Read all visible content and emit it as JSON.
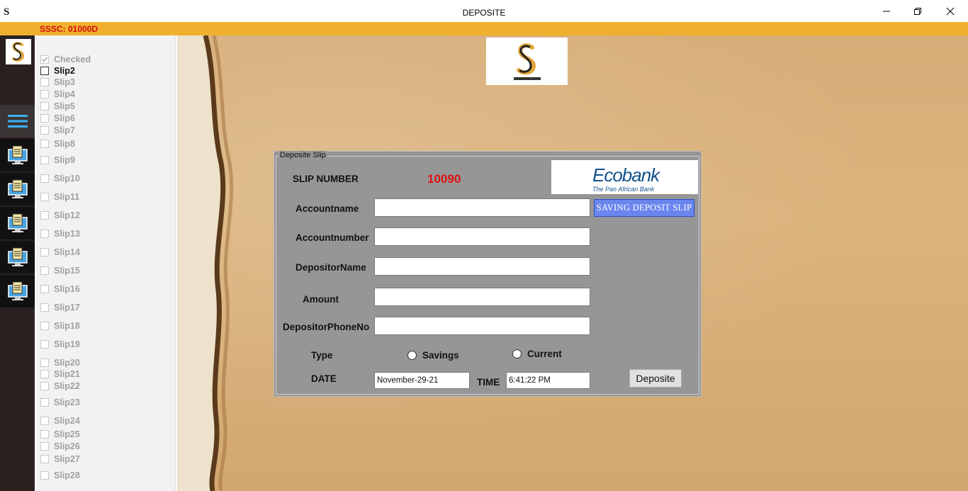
{
  "window": {
    "app_icon": "S",
    "title": "DEPOSITE",
    "controls": [
      "minimize-icon",
      "restore-icon",
      "close-icon"
    ]
  },
  "status": {
    "code": "SSSC: 01000D"
  },
  "slips": {
    "header": "Checked",
    "items": [
      {
        "label": "Slip2",
        "active": true
      },
      {
        "label": "Slip3"
      },
      {
        "label": "Slip4"
      },
      {
        "label": "Slip5"
      },
      {
        "label": "Slip6"
      },
      {
        "label": "Slip7"
      },
      {
        "label": "Slip8"
      },
      {
        "label": "Slip9"
      },
      {
        "label": "Slip10"
      },
      {
        "label": "Slip11"
      },
      {
        "label": "Slip12"
      },
      {
        "label": "Slip13"
      },
      {
        "label": "Slip14"
      },
      {
        "label": "Slip15"
      },
      {
        "label": "Slip16"
      },
      {
        "label": "Slip17"
      },
      {
        "label": "Slip18"
      },
      {
        "label": "Slip19"
      },
      {
        "label": "Slip20"
      },
      {
        "label": "Slip21"
      },
      {
        "label": "Slip22"
      },
      {
        "label": "Slip23"
      },
      {
        "label": "Slip24"
      },
      {
        "label": "Slip25"
      },
      {
        "label": "Slip26"
      },
      {
        "label": "Slip27"
      },
      {
        "label": "Slip28"
      }
    ]
  },
  "form": {
    "group_title": "Deposite Slip",
    "slip_number_label": "SLIP NUMBER",
    "slip_number": "10090",
    "bank_name": "Ecobank",
    "bank_tagline": "The Pan African Bank",
    "saving_button": "SAVING DEPOSIT SLIP",
    "accountname_label": "Accountname",
    "accountname_value": "",
    "accountnumber_label": "Accountnumber",
    "accountnumber_value": "",
    "depositorname_label": "DepositorName",
    "depositorname_value": "",
    "amount_label": "Amount",
    "amount_value": "",
    "phone_label": "DepositorPhoneNo",
    "phone_value": "",
    "type_label": "Type",
    "type_options": [
      "Savings",
      "Current"
    ],
    "date_label": "DATE",
    "date_value": "November-29-21",
    "time_label": "TIME",
    "time_value": "6:41:22 PM",
    "submit_button": "Deposite"
  },
  "colors": {
    "status_bar": "#efb02d",
    "status_text": "#d10f0f",
    "panel": "#969696",
    "slip_number": "#e01010",
    "saving_button": "#6a86ee",
    "sidebar": "#2b2020"
  }
}
